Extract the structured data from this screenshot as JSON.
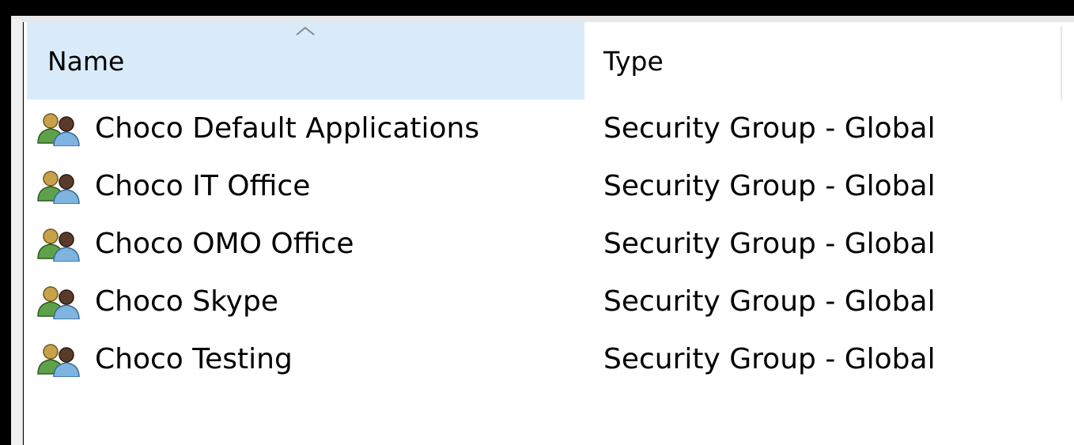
{
  "columns": {
    "name": "Name",
    "type": "Type",
    "sort_icon": "chevron-up-icon"
  },
  "rows": [
    {
      "name": "Choco Default Applications",
      "type": "Security Group - Global",
      "icon": "security-group-icon"
    },
    {
      "name": "Choco IT Office",
      "type": "Security Group - Global",
      "icon": "security-group-icon"
    },
    {
      "name": "Choco OMO Office",
      "type": "Security Group - Global",
      "icon": "security-group-icon"
    },
    {
      "name": "Choco Skype",
      "type": "Security Group - Global",
      "icon": "security-group-icon"
    },
    {
      "name": "Choco Testing",
      "type": "Security Group - Global",
      "icon": "security-group-icon"
    }
  ],
  "colors": {
    "header_selected": "#d9ebf9",
    "background": "#ffffff"
  }
}
